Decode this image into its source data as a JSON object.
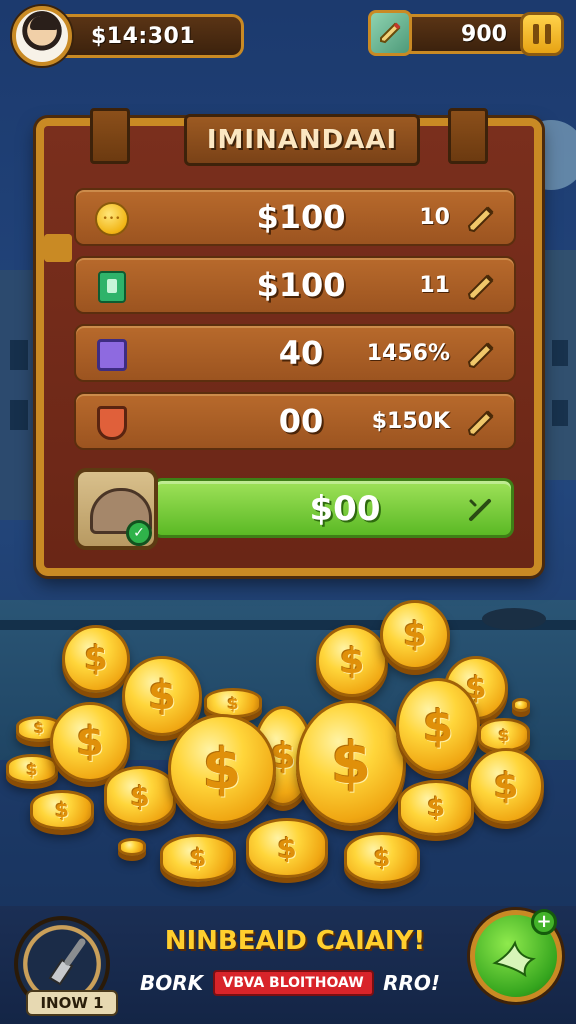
{
  "hud": {
    "cash": "$14:301",
    "gems": "900"
  },
  "panel": {
    "title": "IMINANDAAI",
    "rows": [
      {
        "icon": "coin-icon",
        "value": "$100",
        "count": "10"
      },
      {
        "icon": "green-card-icon",
        "value": "$100",
        "count": "11"
      },
      {
        "icon": "purple-card-icon",
        "value": "40",
        "count": "1456%"
      },
      {
        "icon": "shield-badge-icon",
        "value": "00",
        "count": "$150K"
      }
    ],
    "featured": {
      "icon": "creature-icon",
      "value": "$00"
    }
  },
  "bottom": {
    "tool_label": "INOW",
    "tool_count": "1",
    "promo_title": "NINBEAID CAIAIY!",
    "promo_left": "BORK",
    "promo_badge": "VBVA BLOITHOAW",
    "promo_right": "RRO!"
  },
  "colors": {
    "gold": "#c98a24",
    "panel_red": "#7a2f1d",
    "row_brown": "#b86a2c",
    "green": "#5bb925",
    "promo_yellow": "#ffcf2e",
    "promo_red": "#d8242a"
  }
}
